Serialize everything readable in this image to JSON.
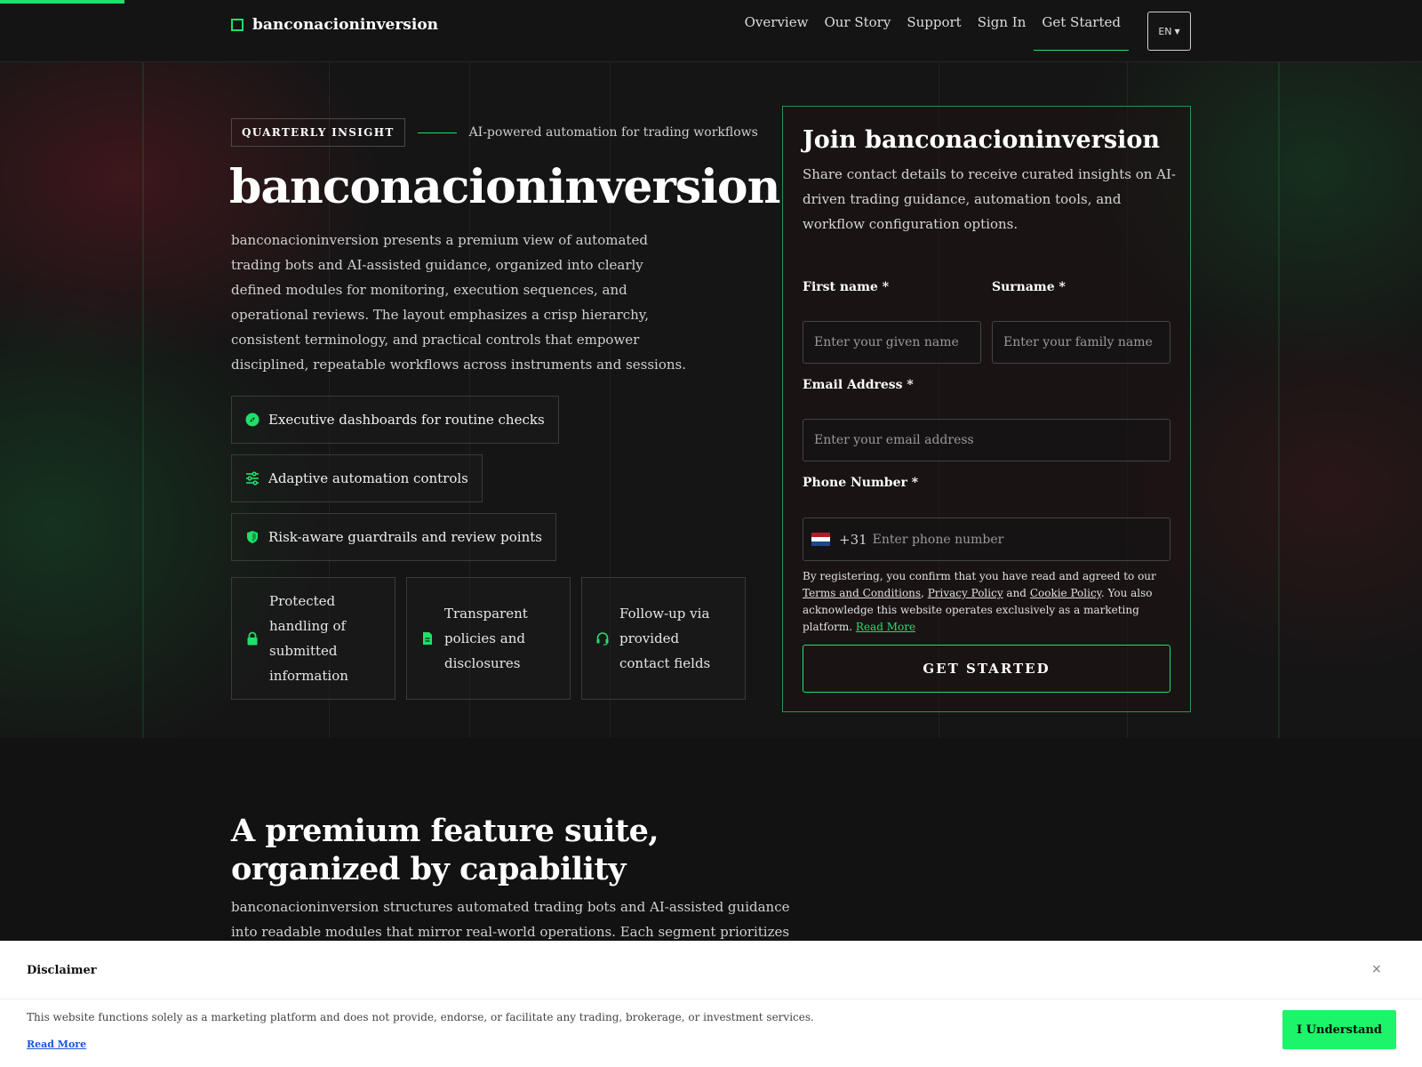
{
  "nav": {
    "brand": "banconacioninversion",
    "links": [
      "Overview",
      "Our Story",
      "Support",
      "Sign In",
      "Get Started"
    ],
    "active_link": "Get Started",
    "language": "EN"
  },
  "hero": {
    "tag": "QUARTERLY INSIGHT",
    "tagline": "AI-powered automation for trading workflows",
    "title": "banconacioninversion",
    "description": "banconacioninversion presents a premium view of automated trading bots and AI-assisted guidance, organized into clearly defined modules for monitoring, execution sequences, and operational reviews. The layout emphasizes a crisp hierarchy, consistent terminology, and practical controls that empower disciplined, repeatable workflows across instruments and sessions.",
    "features": [
      {
        "icon": "compass-icon",
        "label": "Executive dashboards for routine checks"
      },
      {
        "icon": "sliders-icon",
        "label": "Adaptive automation controls"
      },
      {
        "icon": "shield-icon",
        "label": "Risk-aware guardrails and review points"
      }
    ],
    "cards": [
      {
        "icon": "lock-icon",
        "label": "Protected handling of submitted information"
      },
      {
        "icon": "document-icon",
        "label": "Transparent policies and disclosures"
      },
      {
        "icon": "headset-icon",
        "label": "Follow-up via provided contact fields"
      }
    ]
  },
  "form": {
    "title": "Join banconacioninversion",
    "description": "Share contact details to receive curated insights on AI-driven trading guidance, automation tools, and workflow configuration options.",
    "first_name_label": "First name *",
    "first_name_placeholder": "Enter your given name",
    "surname_label": "Surname *",
    "surname_placeholder": "Enter your family name",
    "email_label": "Email Address *",
    "email_placeholder": "Enter your email address",
    "phone_label": "Phone Number *",
    "phone_country": "Netherlands",
    "phone_dial_code": "+31",
    "phone_placeholder": "Enter phone number",
    "consent_prefix": "By registering, you confirm that you have read and agreed to our ",
    "terms_link": "Terms and Conditions",
    "comma": ", ",
    "privacy_link": "Privacy Policy",
    "and_text": " and ",
    "cookie_link": "Cookie Policy",
    "consent_suffix": ". You also acknowledge this website operates exclusively as a marketing platform. ",
    "read_more": "Read More",
    "submit_label": "GET STARTED"
  },
  "section": {
    "title": "A premium feature suite, organized by capability",
    "description": "banconacioninversion structures automated trading bots and AI-assisted guidance into readable modules that mirror real-world operations. Each segment prioritizes clear inputs,"
  },
  "disclaimer": {
    "title": "Disclaimer",
    "close": "×",
    "text": "This website functions solely as a marketing platform and does not provide, endorse, or facilitate any trading, brokerage, or investment services.",
    "read_more": "Read More",
    "button": "I Understand"
  },
  "colors": {
    "accent": "#1fe06a",
    "background": "#121212",
    "button_green": "#1cf46a",
    "link_blue": "#1a56d6"
  }
}
